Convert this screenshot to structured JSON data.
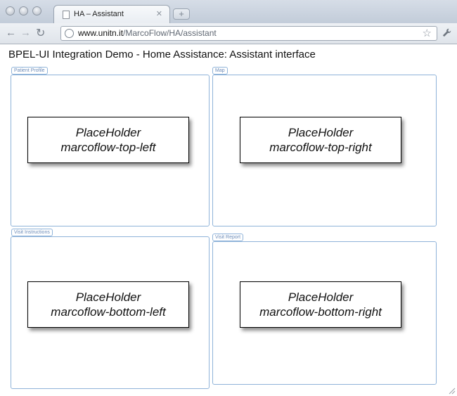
{
  "browser": {
    "tab_title": "HA – Assistant",
    "url_host": "www.unitn.it",
    "url_path": "/MarcoFlow/HA/assistant"
  },
  "icons": {
    "back": "back-arrow-icon",
    "forward": "forward-arrow-icon",
    "reload": "reload-icon",
    "page": "page-icon",
    "security": "globe-icon",
    "bookmark": "star-icon",
    "settings": "wrench-icon"
  },
  "page": {
    "title": "BPEL-UI Integration Demo - Home Assistance: Assistant interface",
    "panels": [
      {
        "legend": "Patient Profile",
        "line1": "PlaceHolder",
        "line2": "marcoflow-top-left"
      },
      {
        "legend": "Map",
        "line1": "PlaceHolder",
        "line2": "marcoflow-top-right"
      },
      {
        "legend": "Visit Instructions",
        "line1": "PlaceHolder",
        "line2": "marcoflow-bottom-left"
      },
      {
        "legend": "Visit Report",
        "line1": "PlaceHolder",
        "line2": "marcoflow-bottom-right"
      }
    ]
  },
  "colors": {
    "panel_border": "#8fb3d9",
    "legend_text": "#6b8bb8"
  }
}
